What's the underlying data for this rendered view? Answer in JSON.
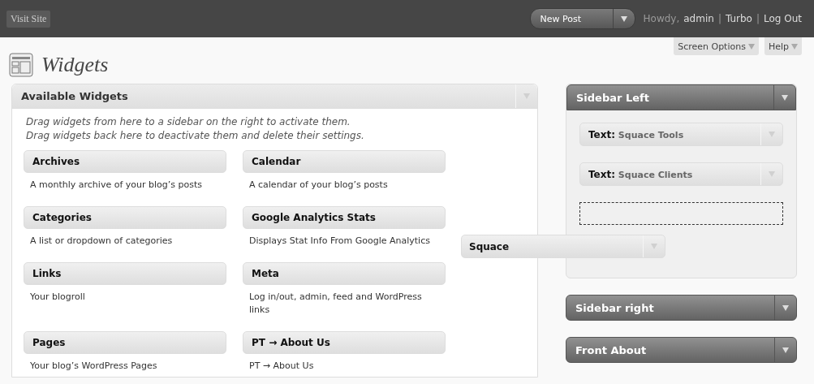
{
  "header": {
    "visit_site": "Visit Site",
    "new_post": "New Post",
    "greeting": "Howdy,",
    "user": "admin",
    "separator": "|",
    "links": [
      "Turbo",
      "Log Out"
    ]
  },
  "screen_tabs": [
    "Screen Options",
    "Help"
  ],
  "page_title": "Widgets",
  "available_widgets": {
    "title": "Available Widgets",
    "description": [
      "Drag widgets from here to a sidebar on the right to activate them.",
      "Drag widgets back here to deactivate them and delete their settings."
    ],
    "widgets": [
      {
        "title": "Archives",
        "description": "A monthly archive of your blog’s posts"
      },
      {
        "title": "Calendar",
        "description": "A calendar of your blog’s posts"
      },
      {
        "title": "Categories",
        "description": "A list or dropdown of categories"
      },
      {
        "title": "Google Analytics Stats",
        "description": "Displays Stat Info From Google Analytics"
      },
      {
        "title": "Links",
        "description": "Your blogroll"
      },
      {
        "title": "Meta",
        "description": "Log in/out, admin, feed and WordPress links"
      },
      {
        "title": "Pages",
        "description": "Your blog’s WordPress Pages"
      },
      {
        "title": "PT → About Us",
        "description": "PT → About Us"
      }
    ]
  },
  "dragged_widget": {
    "title": "Squace"
  },
  "sidebars": [
    {
      "title": "Sidebar Left",
      "expanded": true,
      "drop_placeholder": true,
      "widgets": [
        {
          "type": "Text:",
          "title": "Squace Tools"
        },
        {
          "type": "Text:",
          "title": "Squace Clients"
        }
      ]
    },
    {
      "title": "Sidebar right",
      "expanded": false
    },
    {
      "title": "Front About",
      "expanded": false
    }
  ]
}
